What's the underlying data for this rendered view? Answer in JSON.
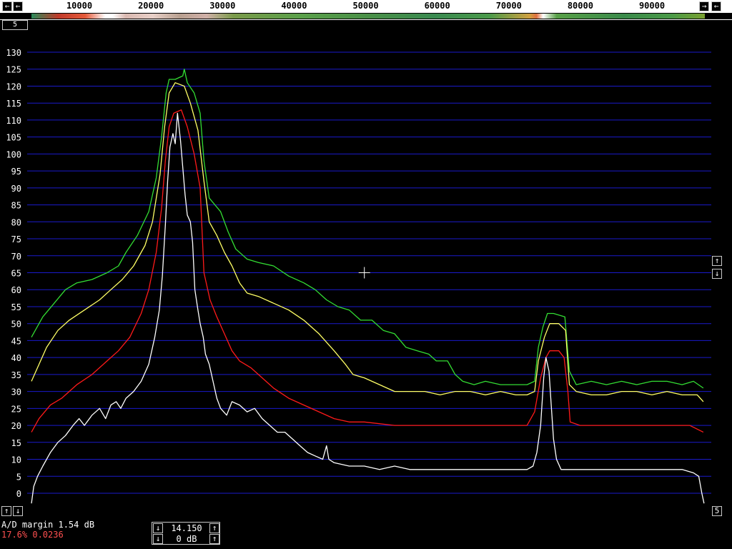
{
  "freq_scale": {
    "ticks": [
      {
        "value": 10000,
        "label": "10000"
      },
      {
        "value": 20000,
        "label": "20000"
      },
      {
        "value": 30000,
        "label": "30000"
      },
      {
        "value": 40000,
        "label": "40000"
      },
      {
        "value": 50000,
        "label": "50000"
      },
      {
        "value": 60000,
        "label": "60000"
      },
      {
        "value": 70000,
        "label": "70000"
      },
      {
        "value": 80000,
        "label": "80000"
      },
      {
        "value": 90000,
        "label": "90000"
      }
    ],
    "left_btn_glyph": "←",
    "right_btn_glyph": "→"
  },
  "left_controls": {
    "up_glyph": "↑",
    "down_glyph": "↓",
    "corner_label": "5"
  },
  "right_controls": {
    "up_glyph": "↑",
    "down_glyph": "↓",
    "corner_label": "5"
  },
  "status": {
    "ad_margin": "A/D margin 1.54 dB",
    "level": "17.6% 0.0236"
  },
  "display_controls": {
    "value1": "14.150",
    "value2": "0 dB",
    "down_glyph": "↓",
    "up_glyph": "↑"
  },
  "colors": {
    "grid": "#1a1acc",
    "white_trace": "#ffffff",
    "red_trace": "#ff1a1a",
    "yellow_trace": "#ffff66",
    "green_trace": "#33dd33"
  },
  "chart_data": {
    "type": "line",
    "xlim": [
      6000,
      95000
    ],
    "ylim": [
      -3,
      131
    ],
    "y_ticks": [
      0,
      5,
      10,
      15,
      20,
      25,
      30,
      35,
      40,
      45,
      50,
      55,
      60,
      65,
      70,
      75,
      80,
      85,
      90,
      95,
      100,
      105,
      110,
      115,
      120,
      125,
      130
    ],
    "grid": true,
    "cursor": {
      "x": 50000,
      "y": 65
    },
    "series": [
      {
        "color_key": "green_trace",
        "points": [
          [
            6000,
            46
          ],
          [
            7500,
            52
          ],
          [
            9000,
            56
          ],
          [
            10500,
            60
          ],
          [
            12000,
            62
          ],
          [
            14000,
            63
          ],
          [
            16000,
            65
          ],
          [
            17500,
            67
          ],
          [
            18500,
            71
          ],
          [
            20000,
            76
          ],
          [
            21500,
            83
          ],
          [
            22500,
            93
          ],
          [
            23200,
            105
          ],
          [
            23800,
            118
          ],
          [
            24200,
            122
          ],
          [
            25000,
            122
          ],
          [
            26000,
            123
          ],
          [
            26200,
            125
          ],
          [
            26600,
            121
          ],
          [
            27500,
            118
          ],
          [
            28300,
            112
          ],
          [
            28800,
            98
          ],
          [
            29500,
            87
          ],
          [
            31000,
            83
          ],
          [
            32000,
            77
          ],
          [
            33000,
            72
          ],
          [
            34500,
            69
          ],
          [
            36000,
            68
          ],
          [
            38000,
            67
          ],
          [
            40000,
            64
          ],
          [
            42000,
            62
          ],
          [
            43500,
            60
          ],
          [
            45000,
            57
          ],
          [
            46500,
            55
          ],
          [
            48000,
            54
          ],
          [
            49500,
            51
          ],
          [
            51000,
            51
          ],
          [
            52500,
            48
          ],
          [
            54000,
            47
          ],
          [
            55500,
            43
          ],
          [
            57000,
            42
          ],
          [
            58500,
            41
          ],
          [
            59500,
            39
          ],
          [
            61000,
            39
          ],
          [
            62000,
            35
          ],
          [
            63000,
            33
          ],
          [
            64500,
            32
          ],
          [
            66000,
            33
          ],
          [
            68000,
            32
          ],
          [
            70000,
            32
          ],
          [
            71500,
            32
          ],
          [
            72500,
            33
          ],
          [
            73000,
            43
          ],
          [
            73600,
            49
          ],
          [
            74200,
            53
          ],
          [
            75000,
            53
          ],
          [
            76500,
            52
          ],
          [
            77100,
            36
          ],
          [
            78000,
            32
          ],
          [
            80000,
            33
          ],
          [
            82000,
            32
          ],
          [
            84000,
            33
          ],
          [
            86000,
            32
          ],
          [
            88000,
            33
          ],
          [
            90000,
            33
          ],
          [
            92000,
            32
          ],
          [
            93500,
            33
          ],
          [
            94800,
            31
          ]
        ]
      },
      {
        "color_key": "yellow_trace",
        "points": [
          [
            6000,
            33
          ],
          [
            7000,
            38
          ],
          [
            8000,
            43
          ],
          [
            9500,
            48
          ],
          [
            11000,
            51
          ],
          [
            13000,
            54
          ],
          [
            15000,
            57
          ],
          [
            16500,
            60
          ],
          [
            18000,
            63
          ],
          [
            19500,
            67
          ],
          [
            21000,
            73
          ],
          [
            22000,
            80
          ],
          [
            23000,
            94
          ],
          [
            23600,
            108
          ],
          [
            24200,
            118
          ],
          [
            25000,
            121
          ],
          [
            26200,
            120
          ],
          [
            27000,
            115
          ],
          [
            28000,
            107
          ],
          [
            28800,
            92
          ],
          [
            29500,
            80
          ],
          [
            30500,
            76
          ],
          [
            31500,
            71
          ],
          [
            32500,
            67
          ],
          [
            33500,
            62
          ],
          [
            34500,
            59
          ],
          [
            36000,
            58
          ],
          [
            38000,
            56
          ],
          [
            40000,
            54
          ],
          [
            42000,
            51
          ],
          [
            44000,
            47
          ],
          [
            46000,
            42
          ],
          [
            47500,
            38
          ],
          [
            48500,
            35
          ],
          [
            50000,
            34
          ],
          [
            52000,
            32
          ],
          [
            54000,
            30
          ],
          [
            56000,
            30
          ],
          [
            58000,
            30
          ],
          [
            60000,
            29
          ],
          [
            62000,
            30
          ],
          [
            64000,
            30
          ],
          [
            66000,
            29
          ],
          [
            68000,
            30
          ],
          [
            70000,
            29
          ],
          [
            71500,
            29
          ],
          [
            72500,
            30
          ],
          [
            73000,
            39
          ],
          [
            73800,
            46
          ],
          [
            74500,
            50
          ],
          [
            75700,
            50
          ],
          [
            76600,
            48
          ],
          [
            77100,
            32
          ],
          [
            78000,
            30
          ],
          [
            80000,
            29
          ],
          [
            82000,
            29
          ],
          [
            84000,
            30
          ],
          [
            86000,
            30
          ],
          [
            88000,
            29
          ],
          [
            90000,
            30
          ],
          [
            92000,
            29
          ],
          [
            94000,
            29
          ],
          [
            94800,
            27
          ]
        ]
      },
      {
        "color_key": "red_trace",
        "points": [
          [
            6000,
            18
          ],
          [
            7000,
            22
          ],
          [
            8500,
            26
          ],
          [
            10000,
            28
          ],
          [
            12000,
            32
          ],
          [
            14000,
            35
          ],
          [
            16000,
            39
          ],
          [
            17500,
            42
          ],
          [
            19000,
            46
          ],
          [
            20500,
            53
          ],
          [
            21500,
            60
          ],
          [
            22500,
            71
          ],
          [
            23200,
            84
          ],
          [
            23700,
            98
          ],
          [
            24200,
            108
          ],
          [
            24800,
            112
          ],
          [
            25800,
            113
          ],
          [
            26600,
            108
          ],
          [
            27500,
            100
          ],
          [
            28300,
            90
          ],
          [
            28800,
            65
          ],
          [
            29600,
            57
          ],
          [
            30500,
            52
          ],
          [
            31500,
            47
          ],
          [
            32500,
            42
          ],
          [
            33500,
            39
          ],
          [
            35000,
            37
          ],
          [
            36500,
            34
          ],
          [
            38000,
            31
          ],
          [
            40000,
            28
          ],
          [
            42000,
            26
          ],
          [
            44000,
            24
          ],
          [
            46000,
            22
          ],
          [
            48000,
            21
          ],
          [
            50000,
            21
          ],
          [
            54000,
            20
          ],
          [
            58000,
            20
          ],
          [
            62000,
            20
          ],
          [
            66000,
            20
          ],
          [
            70000,
            20
          ],
          [
            71500,
            20
          ],
          [
            72500,
            24
          ],
          [
            73300,
            34
          ],
          [
            74000,
            40
          ],
          [
            74500,
            42
          ],
          [
            75700,
            42
          ],
          [
            76400,
            40
          ],
          [
            76900,
            30
          ],
          [
            77200,
            21
          ],
          [
            78500,
            20
          ],
          [
            82000,
            20
          ],
          [
            86000,
            20
          ],
          [
            90000,
            20
          ],
          [
            93000,
            20
          ],
          [
            94800,
            18
          ]
        ]
      },
      {
        "color_key": "white_trace",
        "points": [
          [
            6000,
            -3
          ],
          [
            6300,
            2
          ],
          [
            6800,
            5
          ],
          [
            7500,
            8
          ],
          [
            8500,
            12
          ],
          [
            9500,
            15
          ],
          [
            10500,
            17
          ],
          [
            11500,
            20
          ],
          [
            12300,
            22
          ],
          [
            13000,
            20
          ],
          [
            14000,
            23
          ],
          [
            15000,
            25
          ],
          [
            15800,
            22
          ],
          [
            16500,
            26
          ],
          [
            17200,
            27
          ],
          [
            17800,
            25
          ],
          [
            18500,
            28
          ],
          [
            19500,
            30
          ],
          [
            20500,
            33
          ],
          [
            21500,
            38
          ],
          [
            22300,
            46
          ],
          [
            22900,
            54
          ],
          [
            23300,
            64
          ],
          [
            23700,
            79
          ],
          [
            24000,
            92
          ],
          [
            24300,
            102
          ],
          [
            24700,
            106
          ],
          [
            25000,
            103
          ],
          [
            25300,
            112
          ],
          [
            25700,
            104
          ],
          [
            26000,
            96
          ],
          [
            26300,
            88
          ],
          [
            26600,
            82
          ],
          [
            27000,
            80
          ],
          [
            27300,
            74
          ],
          [
            27600,
            60
          ],
          [
            28000,
            54
          ],
          [
            28300,
            50
          ],
          [
            28700,
            46
          ],
          [
            29000,
            41
          ],
          [
            29500,
            38
          ],
          [
            30000,
            33
          ],
          [
            30500,
            28
          ],
          [
            31000,
            25
          ],
          [
            31800,
            23
          ],
          [
            32500,
            27
          ],
          [
            33500,
            26
          ],
          [
            34500,
            24
          ],
          [
            35500,
            25
          ],
          [
            36500,
            22
          ],
          [
            37500,
            20
          ],
          [
            38500,
            18
          ],
          [
            39500,
            18
          ],
          [
            40500,
            16
          ],
          [
            41500,
            14
          ],
          [
            42500,
            12
          ],
          [
            43500,
            11
          ],
          [
            44500,
            10
          ],
          [
            45000,
            14
          ],
          [
            45300,
            10
          ],
          [
            46000,
            9
          ],
          [
            48000,
            8
          ],
          [
            50000,
            8
          ],
          [
            52000,
            7
          ],
          [
            54000,
            8
          ],
          [
            56000,
            7
          ],
          [
            58000,
            7
          ],
          [
            60000,
            7
          ],
          [
            62000,
            7
          ],
          [
            64000,
            7
          ],
          [
            66000,
            7
          ],
          [
            68000,
            7
          ],
          [
            70000,
            7
          ],
          [
            71500,
            7
          ],
          [
            72300,
            8
          ],
          [
            72800,
            12
          ],
          [
            73300,
            20
          ],
          [
            73700,
            34
          ],
          [
            74000,
            40
          ],
          [
            74400,
            36
          ],
          [
            74700,
            26
          ],
          [
            75000,
            16
          ],
          [
            75400,
            10
          ],
          [
            76000,
            7
          ],
          [
            78000,
            7
          ],
          [
            80000,
            7
          ],
          [
            82000,
            7
          ],
          [
            84000,
            7
          ],
          [
            86000,
            7
          ],
          [
            88000,
            7
          ],
          [
            90000,
            7
          ],
          [
            92000,
            7
          ],
          [
            93500,
            6
          ],
          [
            94200,
            5
          ],
          [
            94600,
            0
          ],
          [
            94900,
            -3
          ]
        ]
      }
    ]
  }
}
